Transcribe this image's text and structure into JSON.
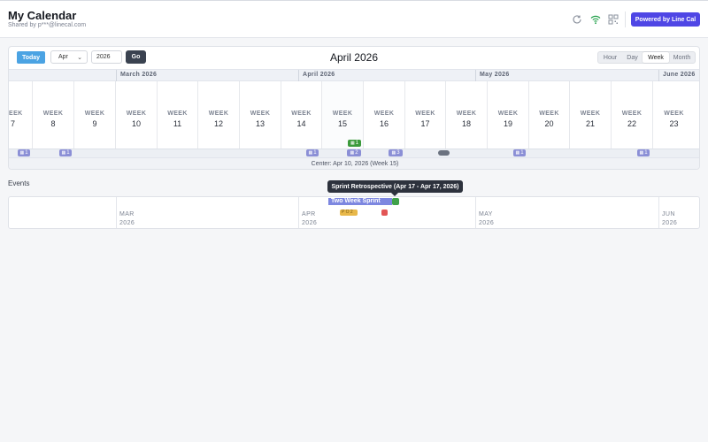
{
  "header": {
    "title": "My Calendar",
    "subtitle": "Shared by p***@linecal.com",
    "powered_label": "Powered by Line Cal",
    "icons": [
      "refresh-icon",
      "wifi-icon",
      "qr-code-icon"
    ],
    "wifi_color": "#22a04a"
  },
  "toolbar": {
    "today_label": "Today",
    "month_value": "Apr",
    "year_value": "2026",
    "go_label": "Go",
    "current_label": "April 2026",
    "view_tabs": [
      "Hour",
      "Day",
      "Week",
      "Month"
    ],
    "active_view": "Week"
  },
  "timeline": {
    "months": [
      "March 2026",
      "April 2026",
      "May 2026",
      "June 2026"
    ],
    "week_word": "WEEK",
    "first_week_word": "EEK",
    "weeks": [
      "7",
      "8",
      "9",
      "10",
      "11",
      "12",
      "13",
      "14",
      "15",
      "16",
      "17",
      "18",
      "19",
      "20",
      "21",
      "22",
      "23"
    ],
    "badges": [
      "1",
      "1",
      "1",
      "2",
      "3",
      "1",
      "1"
    ],
    "green_badge": "1",
    "center_label": "Center: Apr 10, 2026 (Week 15)"
  },
  "events": {
    "section_label": "Events",
    "tooltip": "Sprint Retrospective (Apr 17 - Apr 17, 2026)",
    "months": [
      {
        "name": "MAR",
        "year": "2026"
      },
      {
        "name": "APR",
        "year": "2026"
      },
      {
        "name": "MAY",
        "year": "2026"
      },
      {
        "name": "JUN",
        "year": "2026"
      }
    ],
    "sprint_label": "Two Week Sprint",
    "orange_label": "P O 2",
    "colors": {
      "sprint": "#7d87e0",
      "retro": "#3fa14a",
      "orange": "#e8b84a",
      "red": "#e25555"
    }
  }
}
